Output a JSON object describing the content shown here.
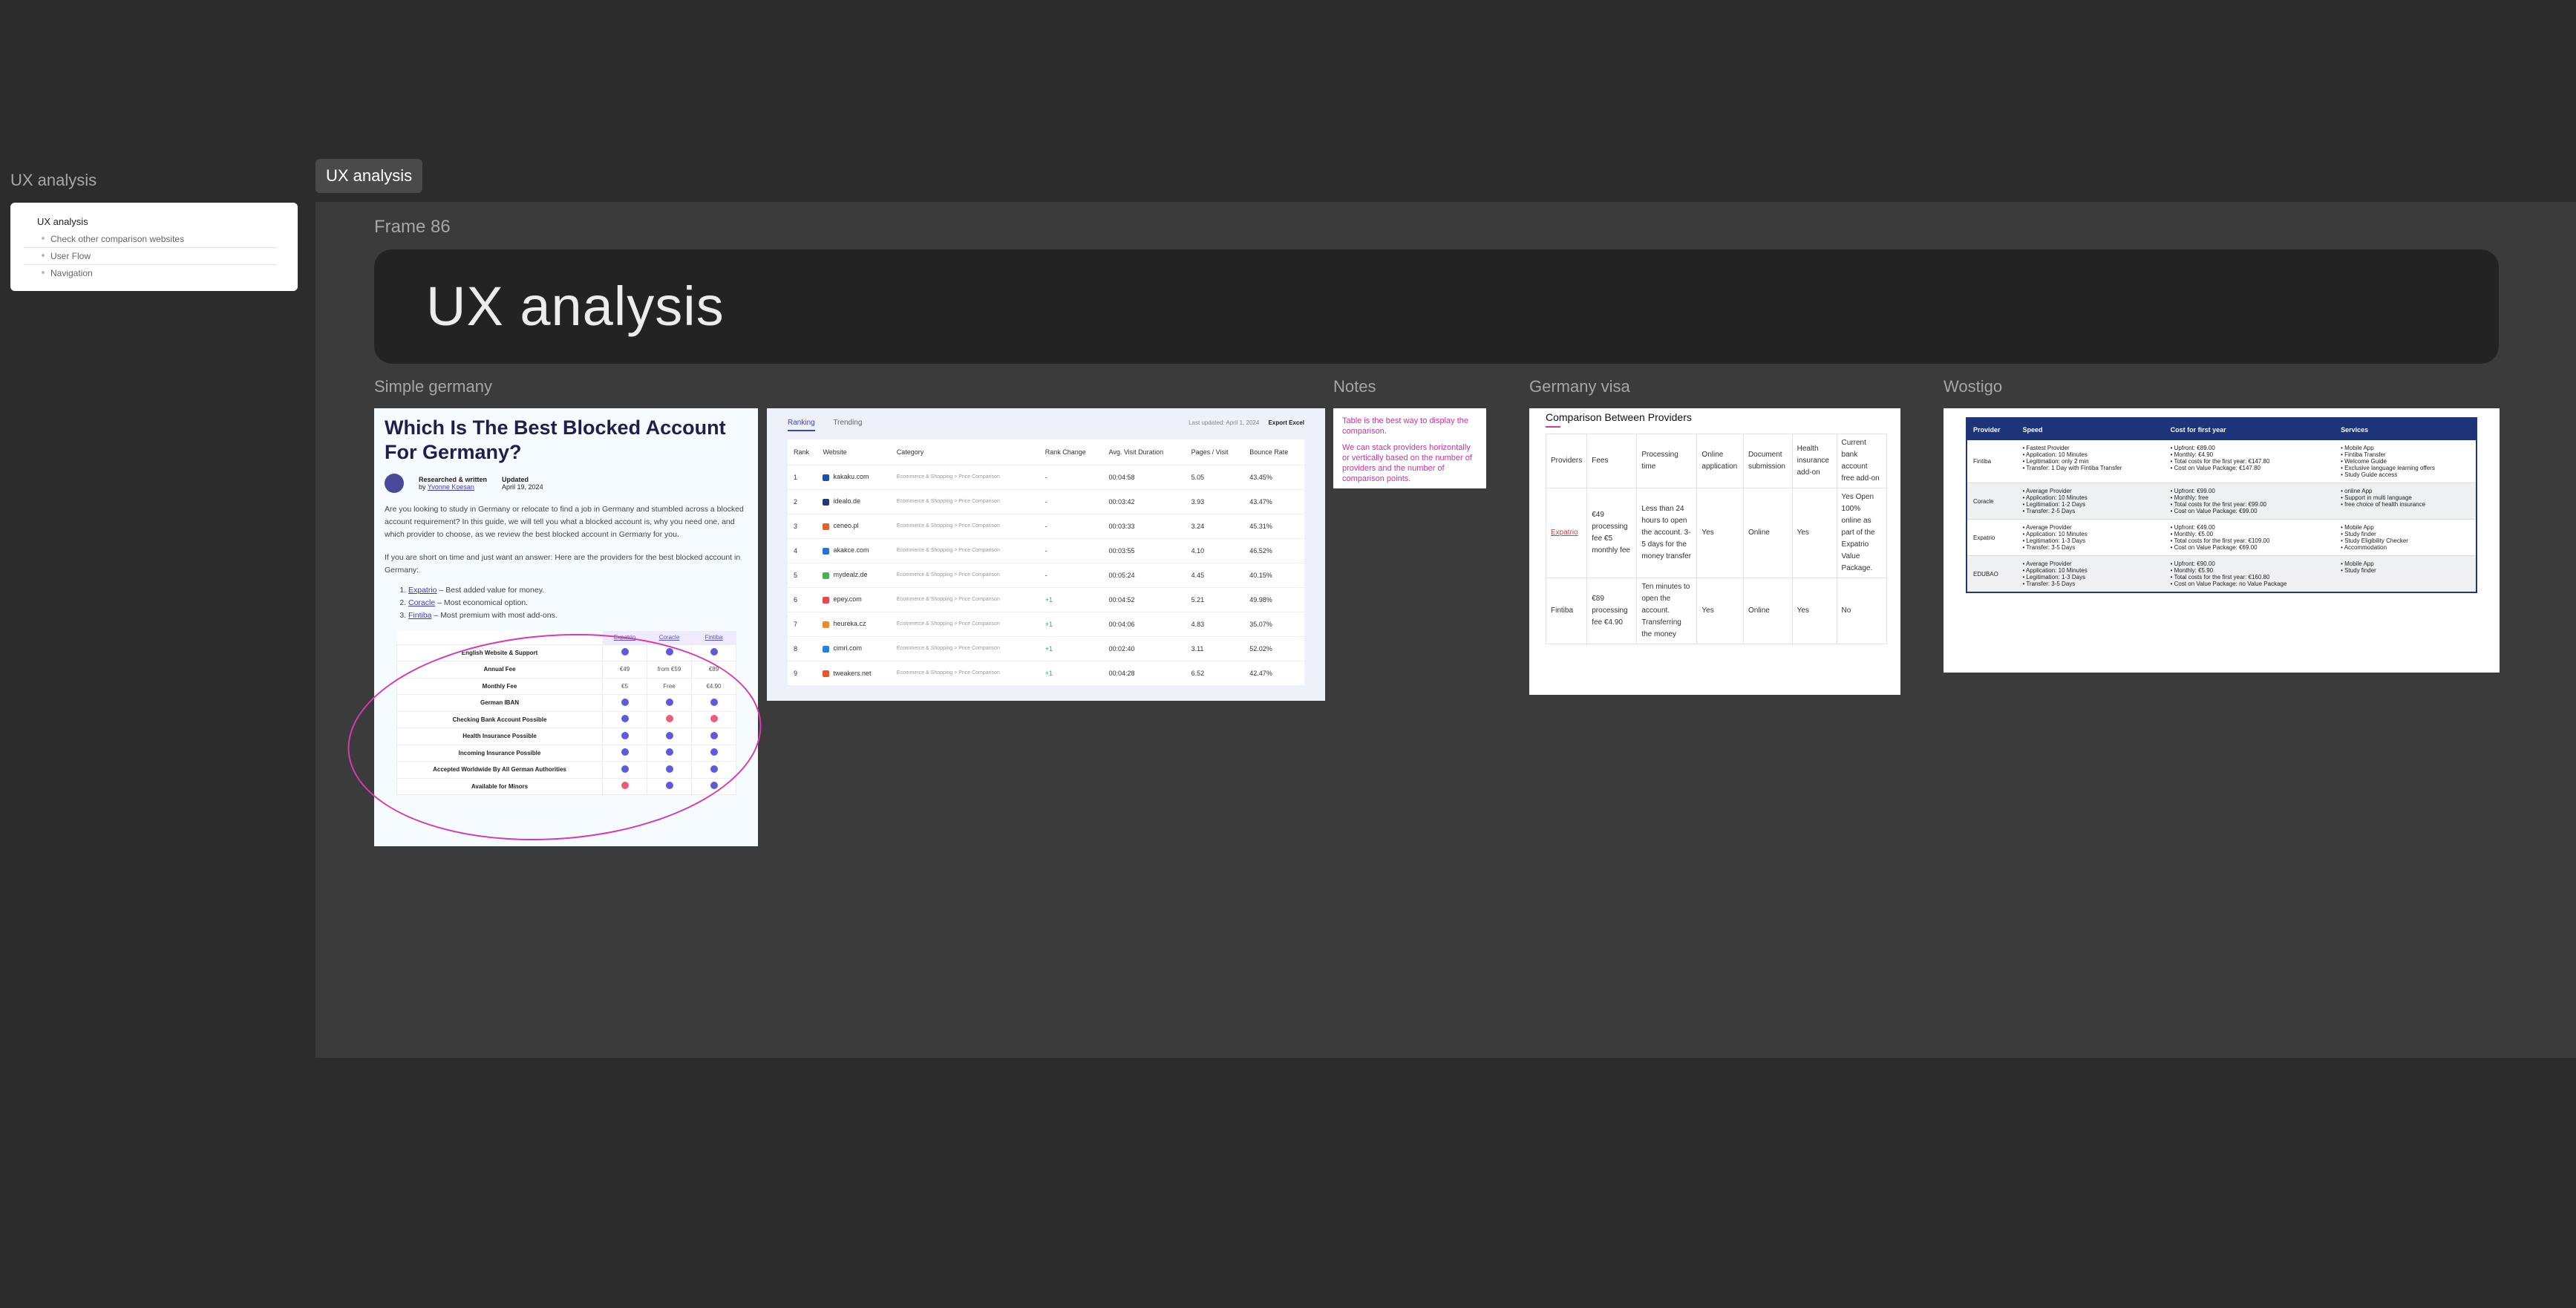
{
  "sidebar": {
    "title": "UX analysis",
    "outline": {
      "heading": "UX analysis",
      "items": [
        "Check other comparison websites",
        "User Flow",
        "Navigation"
      ]
    }
  },
  "tab": {
    "label": "UX analysis"
  },
  "frame": {
    "label": "Frame 86",
    "banner_title": "UX analysis"
  },
  "sections": {
    "simple_germany": "Simple germany",
    "notes": "Notes",
    "germany_visa": "Germany visa",
    "wostigo": "Wostigo"
  },
  "blog": {
    "title": "Which Is The Best Blocked Account For Germany?",
    "author_label": "Researched & written",
    "author_by": "by",
    "author_name": "Yvonne Koesan",
    "updated_label": "Updated",
    "updated_date": "April 19, 2024",
    "para1": "Are you looking to study in Germany or relocate to find a job in Germany and stumbled across a blocked account requirement? In this guide, we will tell you what a blocked account is, why you need one, and which provider to choose, as we review the best blocked account in Germany for you.",
    "para2": "If you are short on time and just want an answer: Here are the providers for the best blocked account in Germany:",
    "list": [
      {
        "name": "Expatrio",
        "desc": " – Best added value for money."
      },
      {
        "name": "Coracle",
        "desc": " – Most economical option."
      },
      {
        "name": "Fintiba",
        "desc": " – Most premium with most add-ons."
      }
    ],
    "table_headers": [
      "Expatrio",
      "Coracle",
      "Fintiba"
    ],
    "table_rows": [
      {
        "label": "English Website & Support",
        "cells": [
          "check",
          "check",
          "check"
        ]
      },
      {
        "label": "Annual Fee",
        "cells": [
          "€49",
          "from €59",
          "€89"
        ]
      },
      {
        "label": "Monthly Fee",
        "cells": [
          "€5",
          "Free",
          "€4.90"
        ]
      },
      {
        "label": "German IBAN",
        "cells": [
          "check",
          "check",
          "check"
        ]
      },
      {
        "label": "Checking Bank Account Possible",
        "cells": [
          "check",
          "x",
          "x"
        ]
      },
      {
        "label": "Health Insurance Possible",
        "cells": [
          "check",
          "check",
          "check"
        ]
      },
      {
        "label": "Incoming Insurance Possible",
        "cells": [
          "check",
          "check",
          "check"
        ]
      },
      {
        "label": "Accepted Worldwide By All German Authorities",
        "cells": [
          "check",
          "check",
          "check"
        ]
      },
      {
        "label": "Available for Minors",
        "cells": [
          "x",
          "check",
          "check"
        ]
      }
    ]
  },
  "ranking": {
    "tabs": [
      "Ranking",
      "Trending"
    ],
    "last_updated": "Last updated: April 1, 2024",
    "export_label": "Export Excel",
    "headers": [
      "Rank",
      "Website",
      "Category",
      "Rank Change",
      "Avg. Visit Duration",
      "Pages / Visit",
      "Bounce Rate"
    ],
    "rows": [
      {
        "rank": "1",
        "site": "kakaku.com",
        "cat": "Ecommerce & Shopping > Price Comparison",
        "change": "-",
        "dur": "00:04:58",
        "pages": "5.05",
        "bounce": "43.45%",
        "color": "#1b4fa8"
      },
      {
        "rank": "2",
        "site": "idealo.de",
        "cat": "Ecommerce & Shopping > Price Comparison",
        "change": "-",
        "dur": "00:03:42",
        "pages": "3.93",
        "bounce": "43.47%",
        "color": "#223a7a"
      },
      {
        "rank": "3",
        "site": "ceneo.pl",
        "cat": "Ecommerce & Shopping > Price Comparison",
        "change": "-",
        "dur": "00:03:33",
        "pages": "3.24",
        "bounce": "45.31%",
        "color": "#e0622c"
      },
      {
        "rank": "4",
        "site": "akakce.com",
        "cat": "Ecommerce & Shopping > Price Comparison",
        "change": "-",
        "dur": "00:03:55",
        "pages": "4.10",
        "bounce": "46.52%",
        "color": "#2f6fd8"
      },
      {
        "rank": "5",
        "site": "mydealz.de",
        "cat": "Ecommerce & Shopping > Price Comparison",
        "change": "-",
        "dur": "00:05:24",
        "pages": "4.45",
        "bounce": "40.15%",
        "color": "#4caf50"
      },
      {
        "rank": "6",
        "site": "epey.com",
        "cat": "Ecommerce & Shopping > Price Comparison",
        "change": "+1",
        "dur": "00:04:52",
        "pages": "5.21",
        "bounce": "49.98%",
        "color": "#e64a4a"
      },
      {
        "rank": "7",
        "site": "heureka.cz",
        "cat": "Ecommerce & Shopping > Price Comparison",
        "change": "+1",
        "dur": "00:04:06",
        "pages": "4.83",
        "bounce": "35.07%",
        "color": "#f08a24"
      },
      {
        "rank": "8",
        "site": "cimri.com",
        "cat": "Ecommerce & Shopping > Price Comparison",
        "change": "+1",
        "dur": "00:02:40",
        "pages": "3.11",
        "bounce": "52.02%",
        "color": "#2a7de1"
      },
      {
        "rank": "9",
        "site": "tweakers.net",
        "cat": "Ecommerce & Shopping > Price Comparison",
        "change": "+1",
        "dur": "00:04:28",
        "pages": "6.52",
        "bounce": "42.47%",
        "color": "#e8592a"
      }
    ]
  },
  "notes": {
    "line1": "Table is the best way to display the comparison.",
    "line2": "We can stack providers horizontally or vertically based on the number of providers and the number of comparison points."
  },
  "visa": {
    "title": "Comparison Between Providers",
    "headers": [
      "Providers",
      "Fees",
      "Processing time",
      "Online application",
      "Document submission",
      "Health insurance add-on",
      "Current bank account free add-on"
    ],
    "rows": [
      [
        "Expatrio",
        "€49 processing fee €5 monthly fee",
        "Less than 24 hours to open the account. 3-5 days for the money transfer",
        "Yes",
        "Online",
        "Yes",
        "Yes Open 100% online as part of the Expatrio Value Package."
      ],
      [
        "Fintiba",
        "€89 processing fee €4.90",
        "Ten minutes to open the account. Transferring the money",
        "Yes",
        "Online",
        "Yes",
        "No"
      ]
    ]
  },
  "wostigo": {
    "headers": [
      "Provider",
      "Speed",
      "Cost for first year",
      "Services"
    ],
    "rows": [
      {
        "name": "Fintiba",
        "speed": [
          "Fastest Provider",
          "Application: 10 Minutes",
          "Legitimation: only 2 min",
          "Transfer: 1 Day with Fintiba Transfer"
        ],
        "cost": [
          "Upfront: €89.00",
          "Monthly: €4.90",
          "Total costs for the first year: €147.80",
          "Cost on Value Package: €147.80"
        ],
        "services": [
          "Mobile App",
          "Fintiba Transfer",
          "Welcome Guide",
          "Exclusive language learning offers",
          "Study Guide access"
        ]
      },
      {
        "name": "Coracle",
        "speed": [
          "Average Provider",
          "Application: 10 Minutes",
          "Legitimation: 1-2 Days",
          "Transfer: 2-5 Days"
        ],
        "cost": [
          "Upfront: €99.00",
          "Monthly: free",
          "Total costs for the first year: €99.00",
          "Cost on Value Package: €99.00"
        ],
        "services": [
          "online App",
          "Support in multi language",
          "free choice of health insurance"
        ]
      },
      {
        "name": "Expatrio",
        "speed": [
          "Average Provider",
          "Application: 10 Minutes",
          "Legitimation: 1-3 Days",
          "Transfer: 3-5 Days"
        ],
        "cost": [
          "Upfront: €49.00",
          "Monthly: €5.00",
          "Total costs for the first year: €109.00",
          "Cost on Value Package: €69.00"
        ],
        "services": [
          "Mobile App",
          "Study finder",
          "Study Eligibility Checker",
          "Accommodation"
        ]
      },
      {
        "name": "EDUBAO",
        "speed": [
          "Average Provider",
          "Application: 10 Minutes",
          "Legitimation: 1-3 Days",
          "Transfer: 3-5 Days"
        ],
        "cost": [
          "Upfront: €90.00",
          "Monthly: €5.90",
          "Total costs for the first year: €160.80",
          "Cost on Value Package: no Value Package"
        ],
        "services": [
          "Mobile App",
          "Study finder"
        ]
      }
    ]
  }
}
